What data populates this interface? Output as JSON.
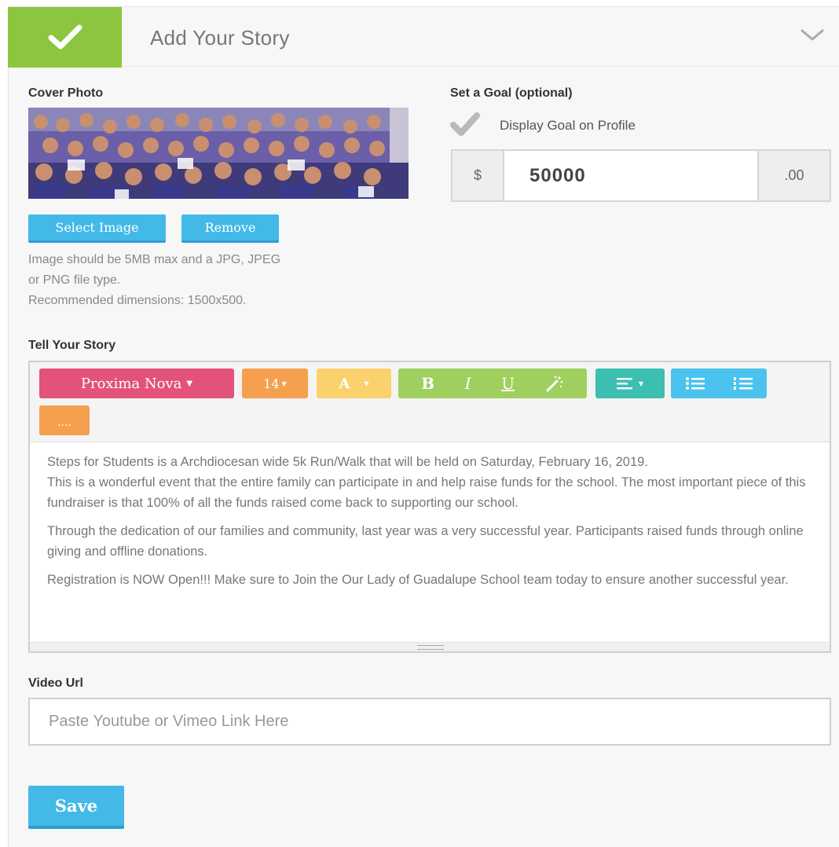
{
  "header": {
    "title": "Add Your Story"
  },
  "cover_photo": {
    "label": "Cover Photo",
    "select_label": "Select Image",
    "remove_label": "Remove",
    "help_lines": [
      "Image should be 5MB max and a JPG, JPEG",
      "or PNG file type.",
      "Recommended dimensions: 1500x500."
    ]
  },
  "goal": {
    "label": "Set a Goal (optional)",
    "display_label": "Display Goal on Profile",
    "display_checked": true,
    "currency_symbol": "$",
    "amount": "50000",
    "cents": ".00"
  },
  "story": {
    "label": "Tell Your Story",
    "toolbar": {
      "font_family": "Proxima Nova",
      "font_size": "14",
      "font_color_label": "A",
      "bold_label": "B",
      "italic_label": "I",
      "underline_label": "U",
      "more_label": "...."
    },
    "paragraphs": [
      "Steps for Students is a Archdiocesan wide 5k Run/Walk that will be held on Saturday, February 16, 2019.",
      "This is a wonderful event that the entire family can participate in and help raise funds for the school. The most important piece of this fundraiser is that 100% of all the funds raised come back to supporting our school.",
      "Through the dedication of our families and community, last year was a very successful year. Participants raised funds through online giving and offline donations.",
      "Registration is NOW Open!!!  Make sure to Join the Our Lady of Guadalupe School team today to ensure another successful year."
    ]
  },
  "video": {
    "label": "Video Url",
    "placeholder": "Paste Youtube or Vimeo Link Here",
    "value": ""
  },
  "save_label": "Save",
  "colors": {
    "success_green": "#8cc63f",
    "primary_blue": "#43b9e8",
    "font_pink": "#e3527a",
    "size_orange": "#f5a04e",
    "color_yellow": "#fbd16e",
    "format_green": "#9fcf5e",
    "align_teal": "#3cbfb0",
    "list_blue": "#4cc3ee"
  }
}
